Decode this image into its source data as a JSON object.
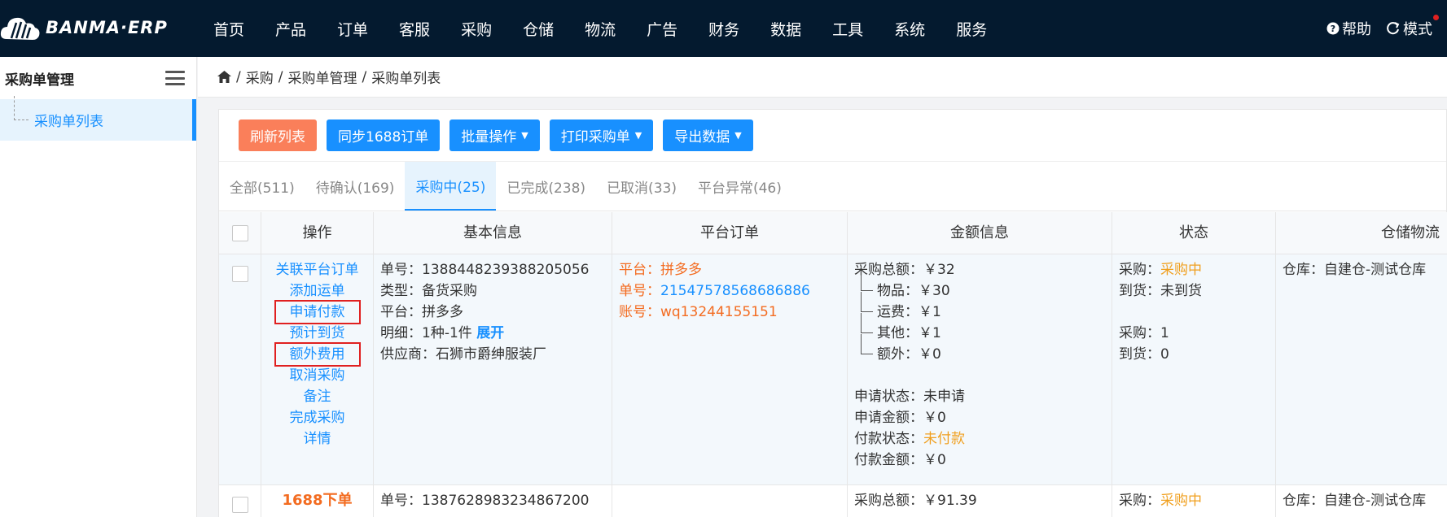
{
  "app": {
    "logo_text": "BANMA·ERP"
  },
  "nav": [
    "首页",
    "产品",
    "订单",
    "客服",
    "采购",
    "仓储",
    "物流",
    "广告",
    "财务",
    "数据",
    "工具",
    "系统",
    "服务"
  ],
  "top_right": {
    "help": "帮助",
    "mode": "模式"
  },
  "sidebar": {
    "title": "采购单管理",
    "items": [
      {
        "label": "采购单列表"
      }
    ]
  },
  "breadcrumb": [
    "采购",
    "采购单管理",
    "采购单列表"
  ],
  "toolbar": {
    "refresh": "刷新列表",
    "sync": "同步1688订单",
    "batch": "批量操作",
    "print": "打印采购单",
    "export": "导出数据"
  },
  "tabs": [
    "全部(511)",
    "待确认(169)",
    "采购中(25)",
    "已完成(238)",
    "已取消(33)",
    "平台异常(46)"
  ],
  "table": {
    "headers": {
      "op": "操作",
      "basic": "基本信息",
      "plat": "平台订单",
      "amt": "金额信息",
      "stat": "状态",
      "store": "仓储物流"
    },
    "row1": {
      "ops": [
        "关联平台订单",
        "添加运单",
        "申请付款",
        "预计到货",
        "额外费用",
        "取消采购",
        "备注",
        "完成采购",
        "详情"
      ],
      "basic": {
        "no_label": "单号：",
        "no": "1388448239388205056",
        "type_label": "类型：",
        "type": "备货采购",
        "plat_label": "平台：",
        "plat": "拼多多",
        "detail_label": "明细：",
        "detail": "1种-1件",
        "expand": "展开",
        "supplier_label": "供应商：",
        "supplier": "石狮市爵绅服装厂"
      },
      "plat": {
        "plat_label": "平台：",
        "plat": "拼多多",
        "no_label": "单号：",
        "no": "2154757856868688​6",
        "acct_label": "账号：",
        "acct": "wq13244155151"
      },
      "amt": {
        "total_label": "采购总额：",
        "total": "￥32",
        "goods_label": "物品：",
        "goods": "￥30",
        "ship_label": "运费：",
        "ship": "￥1",
        "other_label": "其他：",
        "other": "￥1",
        "extra_label": "额外：",
        "extra": "￥0",
        "apply_status_label": "申请状态：",
        "apply_status": "未申请",
        "apply_amt_label": "申请金额：",
        "apply_amt": "￥0",
        "pay_status_label": "付款状态：",
        "pay_status": "未付款",
        "pay_amt_label": "付款金额：",
        "pay_amt": "￥0"
      },
      "stat": {
        "purchase_label": "采购：",
        "purchase": "采购中",
        "arrive_label": "到货：",
        "arrive": "未到货",
        "purchase_n_label": "采购：",
        "purchase_n": "1",
        "arrive_n_label": "到货：",
        "arrive_n": "0"
      },
      "store": {
        "wh_label": "仓库：",
        "wh": "自建仓-测试仓库"
      }
    },
    "row2": {
      "op": "1688下单",
      "basic": {
        "no_label": "单号：",
        "no": "1387628983234867200"
      },
      "amt": {
        "total_label": "采购总额：",
        "total": "￥91.39"
      },
      "stat": {
        "purchase_label": "采购：",
        "purchase": "采购中"
      },
      "store": {
        "wh_label": "仓库：",
        "wh": "自建仓-测试仓库"
      }
    }
  }
}
